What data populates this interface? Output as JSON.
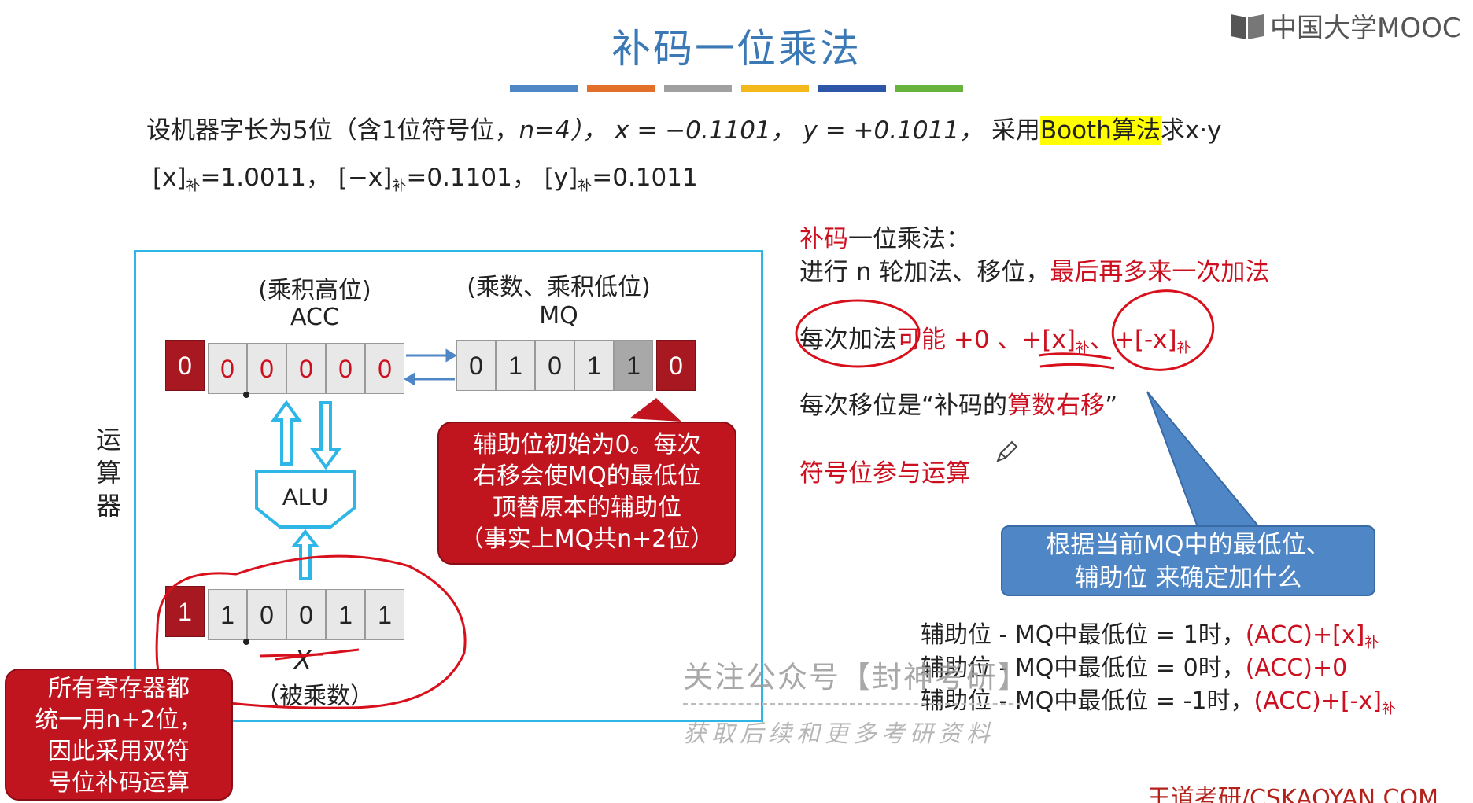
{
  "slide": {
    "title": "补码一位乘法",
    "title_bar_colors": [
      "#4f86c6",
      "#e2702a",
      "#a0a0a0",
      "#f2b81c",
      "#2e56a8",
      "#68b23e"
    ],
    "brand_logo_text": "中国大学MOOC"
  },
  "problem": {
    "line1_prefix": "设机器字长为5位（含1位符号位，",
    "line1_n": "n=4），",
    "line1_x": "x = −0.1101，",
    "line1_y": "y = +0.1011，",
    "line1_use": "采用",
    "line1_booth": "Booth算法",
    "line1_suffix": "求x·y",
    "line2_a": "[x]",
    "line2_a_sub": "补",
    "line2_a_val": "=1.0011，",
    "line2_b": "[−x]",
    "line2_b_sub": "补",
    "line2_b_val": "=0.1101，",
    "line2_c": "[y]",
    "line2_c_sub": "补",
    "line2_c_val": "=0.1011"
  },
  "diagram": {
    "unit_label": "运算器",
    "acc_desc": "(乘积高位)",
    "acc_name": "ACC",
    "mq_desc": "(乘数、乘积低位)",
    "mq_name": "MQ",
    "acc_cells": [
      "0",
      "0",
      "0",
      "0",
      "0",
      "0"
    ],
    "mq_cells": [
      "0",
      "1",
      "0",
      "1",
      "1"
    ],
    "aux_cell": "0",
    "alu_label": "ALU",
    "x_cells": [
      "1",
      "1",
      "0",
      "0",
      "1",
      "1"
    ],
    "x_name": "X",
    "x_desc": "（被乘数）",
    "callout_aux": [
      "辅助位初始为0。每次",
      "右移会使MQ的最低位",
      "顶替原本的辅助位",
      "（事实上MQ共n+2位）"
    ],
    "callout_regs": [
      "所有寄存器都",
      "统一用n+2位，",
      "因此采用双符",
      "号位补码运算"
    ]
  },
  "notes": {
    "heading_red": "补码",
    "heading_black": "一位乘法：",
    "line_rounds": "进行 n 轮加法、移位，",
    "line_rounds_red": "最后再多来一次加法",
    "each_add": "每次加法",
    "each_add_red": "可能 +0 、+[x]",
    "each_add_sub1": "补",
    "each_add_sep": "、+[-x]",
    "each_add_sub2": "补",
    "each_shift": "每次移位是“补码的",
    "each_shift_red": "算数右移",
    "each_shift_end": "”",
    "sign_bit": "符号位参与运算",
    "blue_box": [
      "根据当前MQ中的最低位、",
      "辅助位 来确定加什么"
    ],
    "rules": [
      {
        "text": "辅助位 - MQ中最低位 = 1时，",
        "op": "(ACC)+[x]",
        "sub": "补"
      },
      {
        "text": "辅助位 - MQ中最低位 = 0时，",
        "op": "(ACC)+0",
        "sub": ""
      },
      {
        "text": "辅助位 - MQ中最低位 = -1时，",
        "op": "(ACC)+[-x]",
        "sub": "补"
      }
    ]
  },
  "watermark": {
    "line1": "关注公众号【封神考研】",
    "line2": "获取后续和更多考研资料"
  },
  "footer": "王道考研/CSKAOYAN.COM"
}
